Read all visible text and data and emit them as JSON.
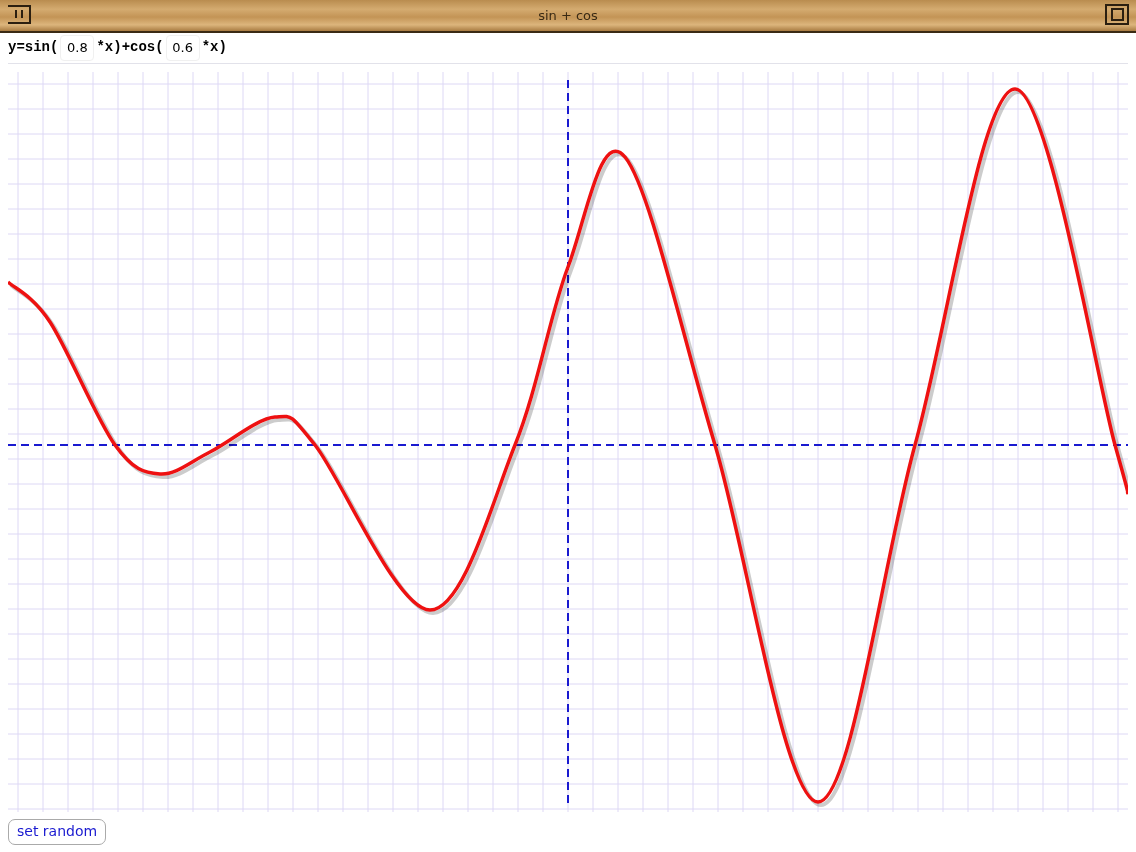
{
  "window": {
    "title": "sin + cos"
  },
  "formula": [
    {
      "kind": "text",
      "text": "y=sin("
    },
    {
      "kind": "field",
      "value": "0.8"
    },
    {
      "kind": "text",
      "text": "*x)+cos("
    },
    {
      "kind": "field",
      "value": "0.6"
    },
    {
      "kind": "text",
      "text": "*x)"
    }
  ],
  "buttons": [
    {
      "label": "set random"
    }
  ]
}
